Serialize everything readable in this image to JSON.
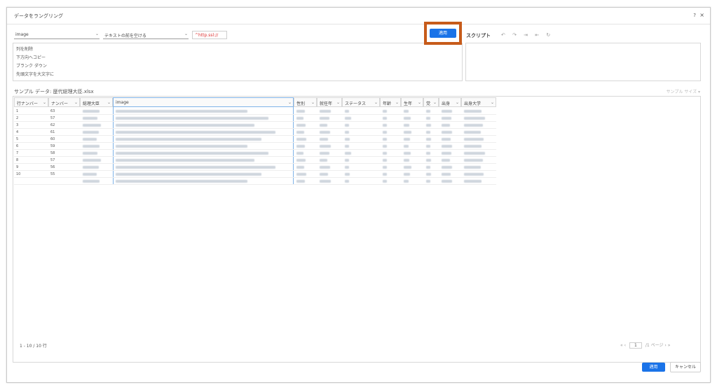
{
  "dialog": {
    "title": "データをラングリング",
    "help": "?",
    "close": "×"
  },
  "toolbar": {
    "column_select": "image",
    "action_select": "テキストの前を空ける",
    "find_input": "^http.ssl://"
  },
  "suggestions": [
    "列を削除",
    "下方向へコピー",
    "ブランク ダウン",
    "先頭文字を大文字に"
  ],
  "apply_label": "適用",
  "script": {
    "label": "スクリプト",
    "tools": "↶ ↷ ⇥ ⇤ ↻"
  },
  "sample": {
    "label": "サンプル データ: 歴代総理大臣.xlsx",
    "size_label": "サンプル サイズ ▾"
  },
  "columns": [
    {
      "label": "行ナンバー"
    },
    {
      "label": "ナンバー"
    },
    {
      "label": "総理大臣"
    },
    {
      "label": "image"
    },
    {
      "label": "性別"
    },
    {
      "label": "就任年"
    },
    {
      "label": "ステータス"
    },
    {
      "label": "年齢"
    },
    {
      "label": "生年"
    },
    {
      "label": "党"
    },
    {
      "label": "出身"
    },
    {
      "label": "出身大学"
    }
  ],
  "rows": [
    {
      "row": "1",
      "num": "63"
    },
    {
      "row": "2",
      "num": "57"
    },
    {
      "row": "3",
      "num": "62"
    },
    {
      "row": "4",
      "num": "61"
    },
    {
      "row": "5",
      "num": "60"
    },
    {
      "row": "6",
      "num": "59"
    },
    {
      "row": "7",
      "num": "58"
    },
    {
      "row": "8",
      "num": "57"
    },
    {
      "row": "9",
      "num": "56"
    },
    {
      "row": "10",
      "num": "55"
    }
  ],
  "footer": {
    "row_count": "1 - 10 / 10 行",
    "pager_prev": "« ‹",
    "pager_page": "1",
    "pager_total": "/1 ページ",
    "pager_next": "› »",
    "apply": "適用",
    "cancel": "キャンセル"
  },
  "colors": {
    "accent": "#1a73e8",
    "highlight_frame": "#c75b1a",
    "active_column": "#7fb3e8"
  }
}
